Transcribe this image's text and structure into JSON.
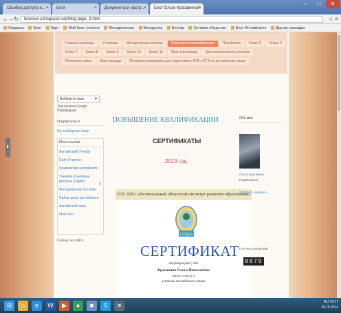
{
  "browser": {
    "tabs": [
      {
        "label": "Ошибки доступа к...",
        "active": false
      },
      {
        "label": "Блог",
        "active": false
      },
      {
        "label": "Документы и настр...",
        "active": false
      },
      {
        "label": "Блог Ольги Красавиной",
        "active": true
      }
    ],
    "url": "krasova-o.blogspot.ru/p/blog-page_9.html",
    "bookmarks": [
      "Сервисы",
      "Блог",
      "Карт",
      "Мой блог учителя",
      "Методическая",
      "Методичка",
      "Блогер",
      "Сетевое общество",
      "Блог Английского",
      "Другие закладки"
    ],
    "window_controls": [
      "minimize",
      "maximize",
      "close"
    ]
  },
  "site": {
    "menu_rows": [
      [
        "Главная страница",
        "Ученикам",
        "Методическая копилка",
        "Повышение квалификации",
        "Портфолио",
        "Класс 5",
        "Класс 6"
      ],
      [
        "Класс 7",
        "Класс 8",
        "Класс 9",
        "Класс 10",
        "Класс 11",
        "Мои публикации",
        "Достижения моих учеников"
      ],
      [
        "Полезные сайты",
        "Мои награды",
        "Полезные материалы для подготовки к ГИА и ЕГЭ по английскому языку"
      ]
    ],
    "active_menu": "Повышение квалификации"
  },
  "sidebar": {
    "select_value": "Выберите язык",
    "powered": "Технологии Google Переводчик",
    "section1_head": "Подписаться",
    "section1_link": "На сообщения Atom",
    "section2_head": "Мои ссылки",
    "links": [
      "Английский (Учеба)",
      "Сайт Учителя",
      "Грамматика английского",
      "Ученики и учебные ресурсы English",
      "Методическое пособие",
      "Сайты школ английского",
      "Английский язык",
      "Мой блог"
    ],
    "counter_line": "Сейчас на сайте"
  },
  "main": {
    "heading": "ПОВЫШЕНИЕ КВАЛИФИКАЦИИ",
    "subheading": "СЕРТИФИКАТЫ",
    "year": "2013 год",
    "cert_header": "ГОУ ДПО «Региональный областной институт развития образования»",
    "cert_title": "СЕРТИФИКАТ",
    "cert_given": "подтверждает, что",
    "cert_name": "Красавина Ольга Николаевна",
    "cert_school": "МБОУ СОШ № 5",
    "cert_role": "учитель английского языка",
    "emblem_text": "Lingua"
  },
  "right_column": {
    "head": "Обо мне",
    "profile_name": "Ольга Красавина",
    "profile_link": "Подписаться",
    "full_profile": "Смотреть профиль",
    "counter_label": "Счетчик посещений",
    "counter_value": "0879"
  },
  "taskbar": {
    "icons": [
      {
        "name": "start-icon",
        "color": "#3a9ad9",
        "glyph": "⊞"
      },
      {
        "name": "explorer-icon",
        "color": "#e8b23a",
        "glyph": "⌂"
      },
      {
        "name": "ie-icon",
        "color": "#2d8fd6",
        "glyph": "e"
      },
      {
        "name": "word-icon",
        "color": "#2b579a",
        "glyph": "W"
      },
      {
        "name": "media-icon",
        "color": "#d35c2b",
        "glyph": "▶"
      },
      {
        "name": "chrome-icon",
        "color": "#3a9a5b",
        "glyph": "●"
      },
      {
        "name": "folder-icon",
        "color": "#6b8fc8",
        "glyph": "■"
      },
      {
        "name": "skype-icon",
        "color": "#1e9ee0",
        "glyph": "S"
      },
      {
        "name": "network-icon",
        "color": "#5a6a7a",
        "glyph": "≡"
      }
    ],
    "tray_time": "14:17",
    "tray_date": "19.10.2014",
    "tray_lang": "RU"
  }
}
